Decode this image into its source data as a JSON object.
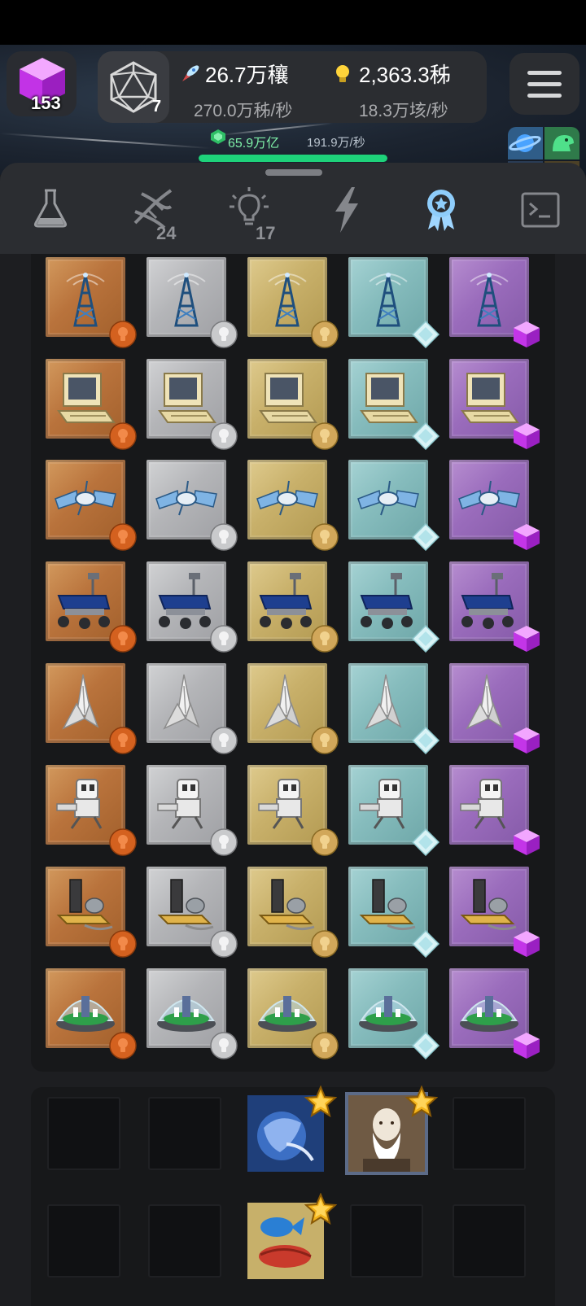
{
  "header": {
    "cube_count": "153",
    "d20_count": "7",
    "rocket_value": "26.7万穰",
    "rocket_rate": "270.0万秭/秒",
    "idea_value": "2,363.3秭",
    "idea_rate": "18.3万垓/秒",
    "gem_value": "65.9万亿",
    "gem_rate": "191.9万/秒",
    "xp_progress_fraction": 1.0
  },
  "world_tiles": {
    "left_count": "1",
    "right_count": "6"
  },
  "tabs": [
    {
      "name": "tab-science",
      "icon": "flask-icon",
      "badge": ""
    },
    {
      "name": "tab-dna",
      "icon": "dna-icon",
      "badge": "24"
    },
    {
      "name": "tab-ideas",
      "icon": "lightbulb-icon",
      "badge": "17"
    },
    {
      "name": "tab-power",
      "icon": "lightning-icon",
      "badge": ""
    },
    {
      "name": "tab-awards",
      "icon": "award-ribbon-icon",
      "badge": "",
      "active": true
    },
    {
      "name": "tab-console",
      "icon": "terminal-icon",
      "badge": ""
    }
  ],
  "tiers": [
    {
      "tier": "bronze",
      "indicator": "bronze-bulb-icon"
    },
    {
      "tier": "silver",
      "indicator": "silver-bulb-icon"
    },
    {
      "tier": "gold",
      "indicator": "gold-bulb-icon"
    },
    {
      "tier": "diamond",
      "indicator": "diamond-icon"
    },
    {
      "tier": "cube",
      "indicator": "purple-cube-icon"
    }
  ],
  "item_rows": [
    {
      "item": "radio-tower",
      "icon": "radio-tower-icon"
    },
    {
      "item": "computer",
      "icon": "retro-computer-icon"
    },
    {
      "item": "satellite",
      "icon": "satellite-icon"
    },
    {
      "item": "rover",
      "icon": "mars-rover-icon"
    },
    {
      "item": "space-shuttle",
      "icon": "space-shuttle-icon"
    },
    {
      "item": "robot",
      "icon": "robot-icon"
    },
    {
      "item": "reactor",
      "icon": "reactor-tower-icon"
    },
    {
      "item": "biodome",
      "icon": "biodome-icon"
    }
  ],
  "selection": [
    {
      "slot": 2,
      "row": 0,
      "icon": "planet-globe-art-icon",
      "star": true,
      "framed": false
    },
    {
      "slot": 3,
      "row": 0,
      "icon": "darwin-portrait-icon",
      "star": true,
      "framed": true
    },
    {
      "slot": 2,
      "row": 1,
      "icon": "dna-fish-art-icon",
      "star": true,
      "framed": false
    }
  ],
  "colors": {
    "background": "#1d1e21",
    "panel": "#2b2d31",
    "xp_bar": "#1ed27a",
    "bronze": "#b9733c",
    "silver": "#b4b5b8",
    "gold": "#c8b06a",
    "diamond": "#86bcbd",
    "cube": "#9a6cbc"
  }
}
